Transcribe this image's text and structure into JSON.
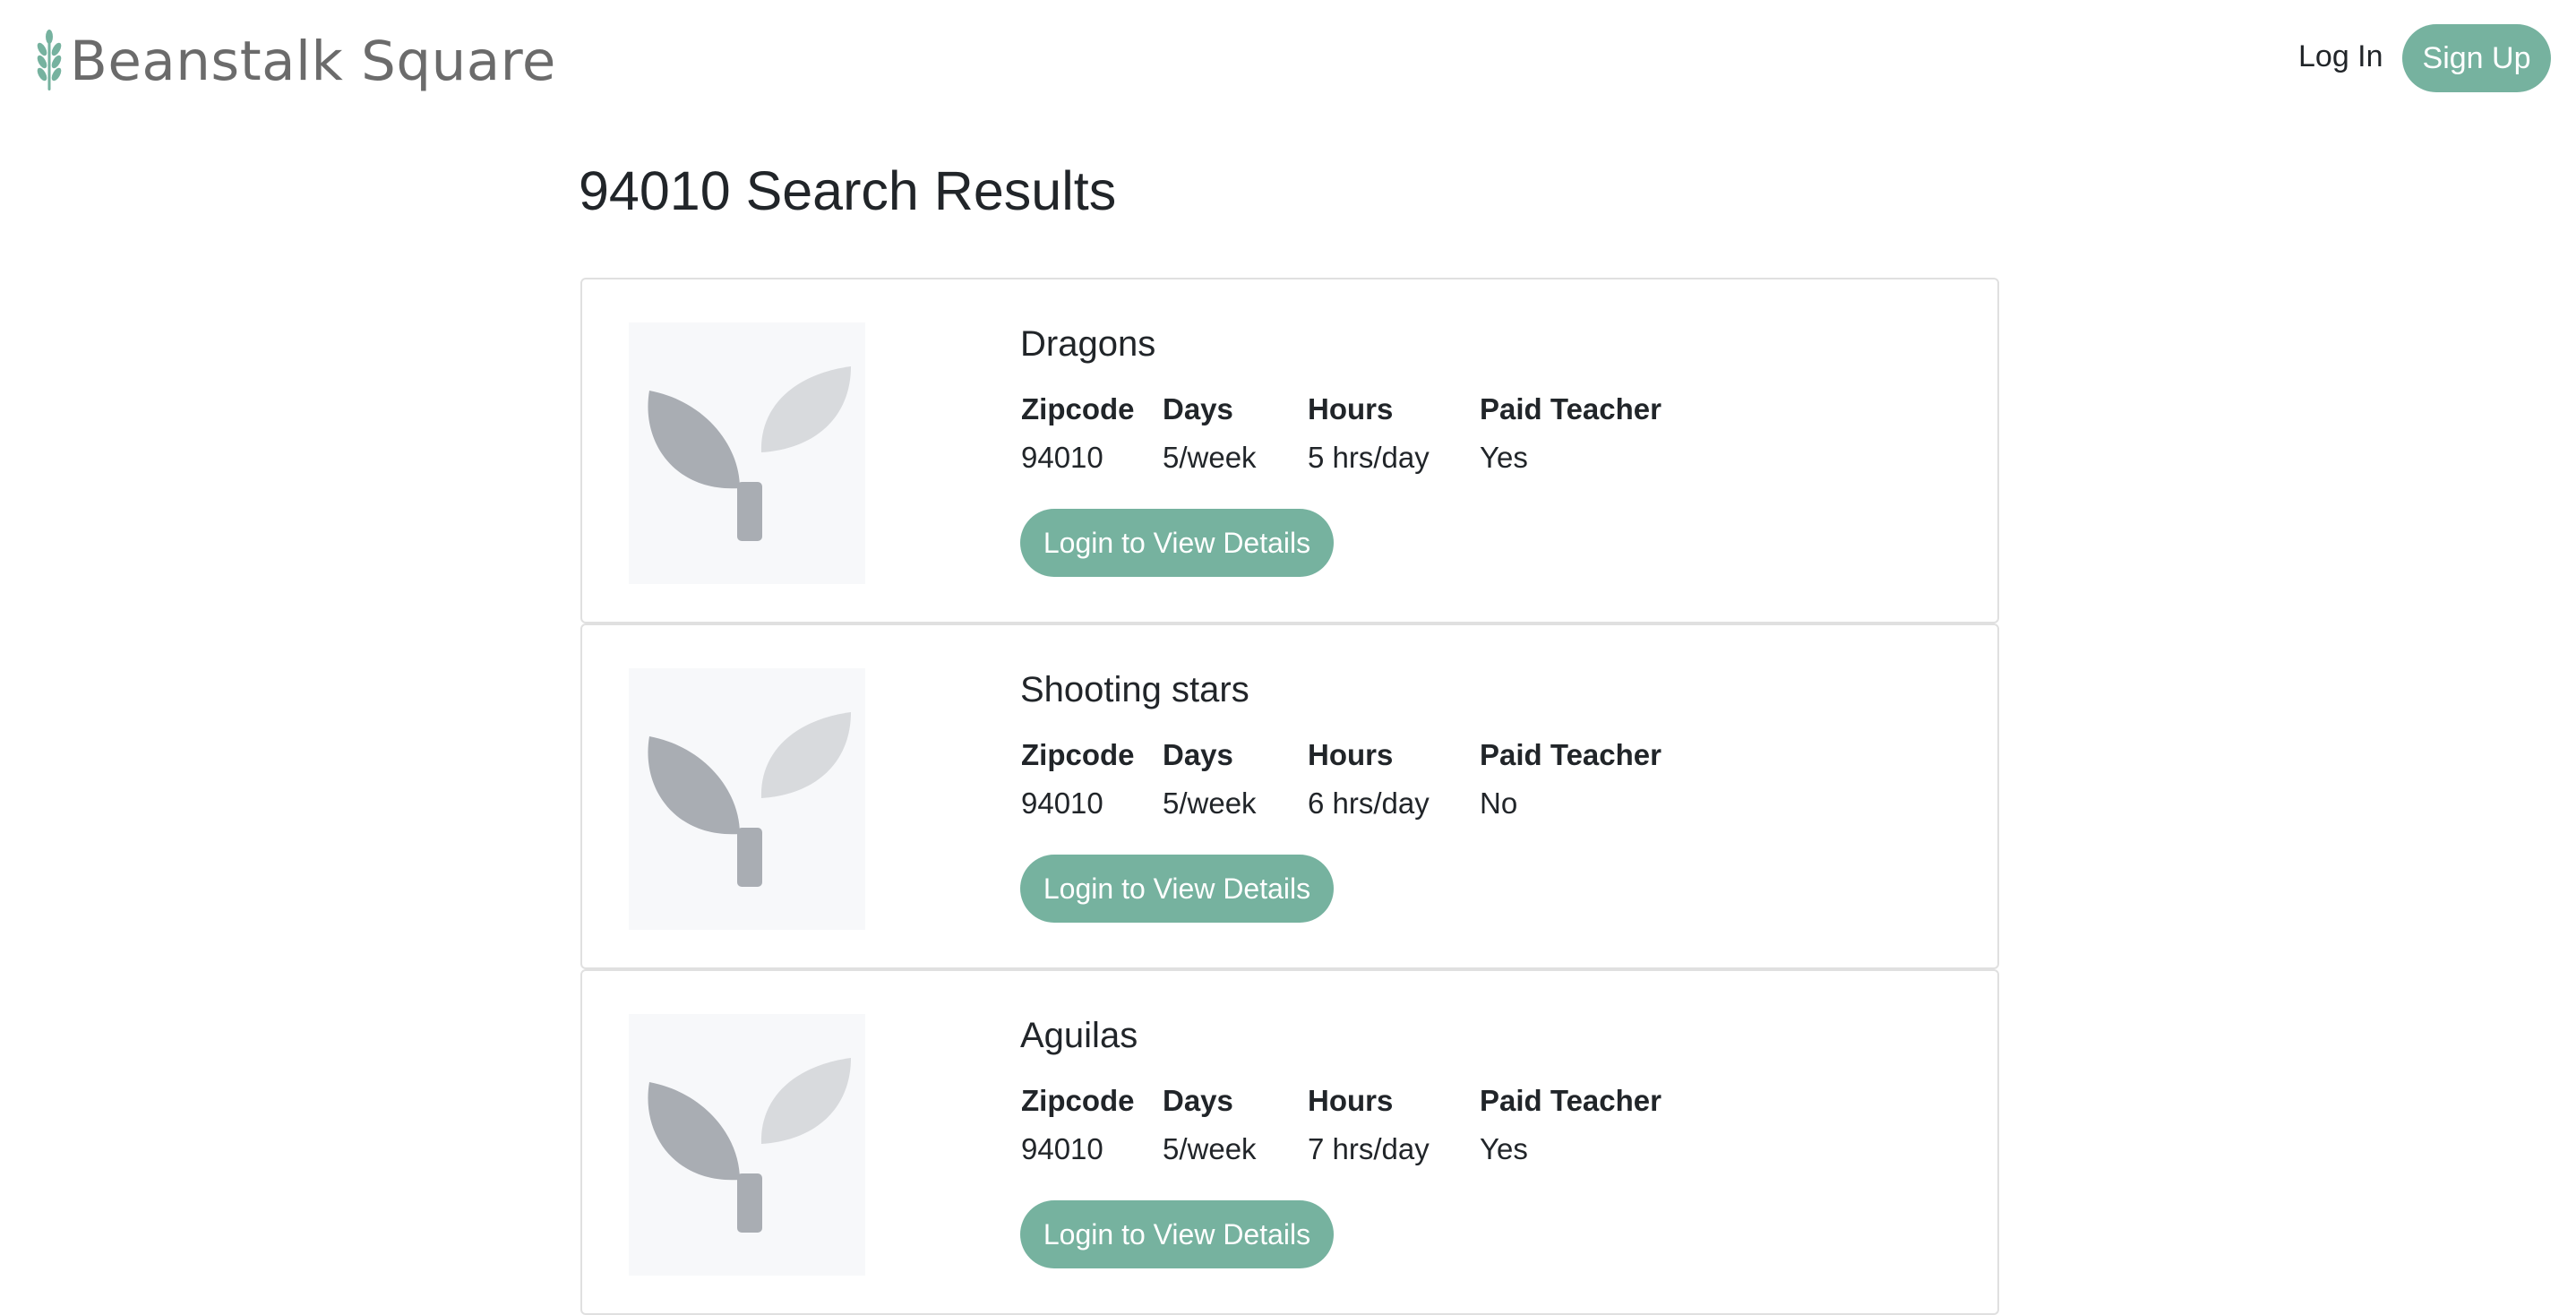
{
  "header": {
    "brand": "Beanstalk Square",
    "login_label": "Log In",
    "signup_label": "Sign Up"
  },
  "colors": {
    "accent": "#76b29f",
    "brand_text": "#6b6b6b",
    "placeholder_bg": "#f7f8fa"
  },
  "page": {
    "title": "94010 Search Results"
  },
  "results": {
    "headers": {
      "zipcode": "Zipcode",
      "days": "Days",
      "hours": "Hours",
      "paid": "Paid Teacher"
    },
    "items": [
      {
        "name": "Dragons",
        "zipcode": "94010",
        "days": "5/week",
        "hours": "5 hrs/day",
        "paid": "Yes",
        "button": "Login to View Details"
      },
      {
        "name": "Shooting stars",
        "zipcode": "94010",
        "days": "5/week",
        "hours": "6 hrs/day",
        "paid": "No",
        "button": "Login to View Details"
      },
      {
        "name": "Aguilas",
        "zipcode": "94010",
        "days": "5/week",
        "hours": "7 hrs/day",
        "paid": "Yes",
        "button": "Login to View Details"
      }
    ]
  }
}
